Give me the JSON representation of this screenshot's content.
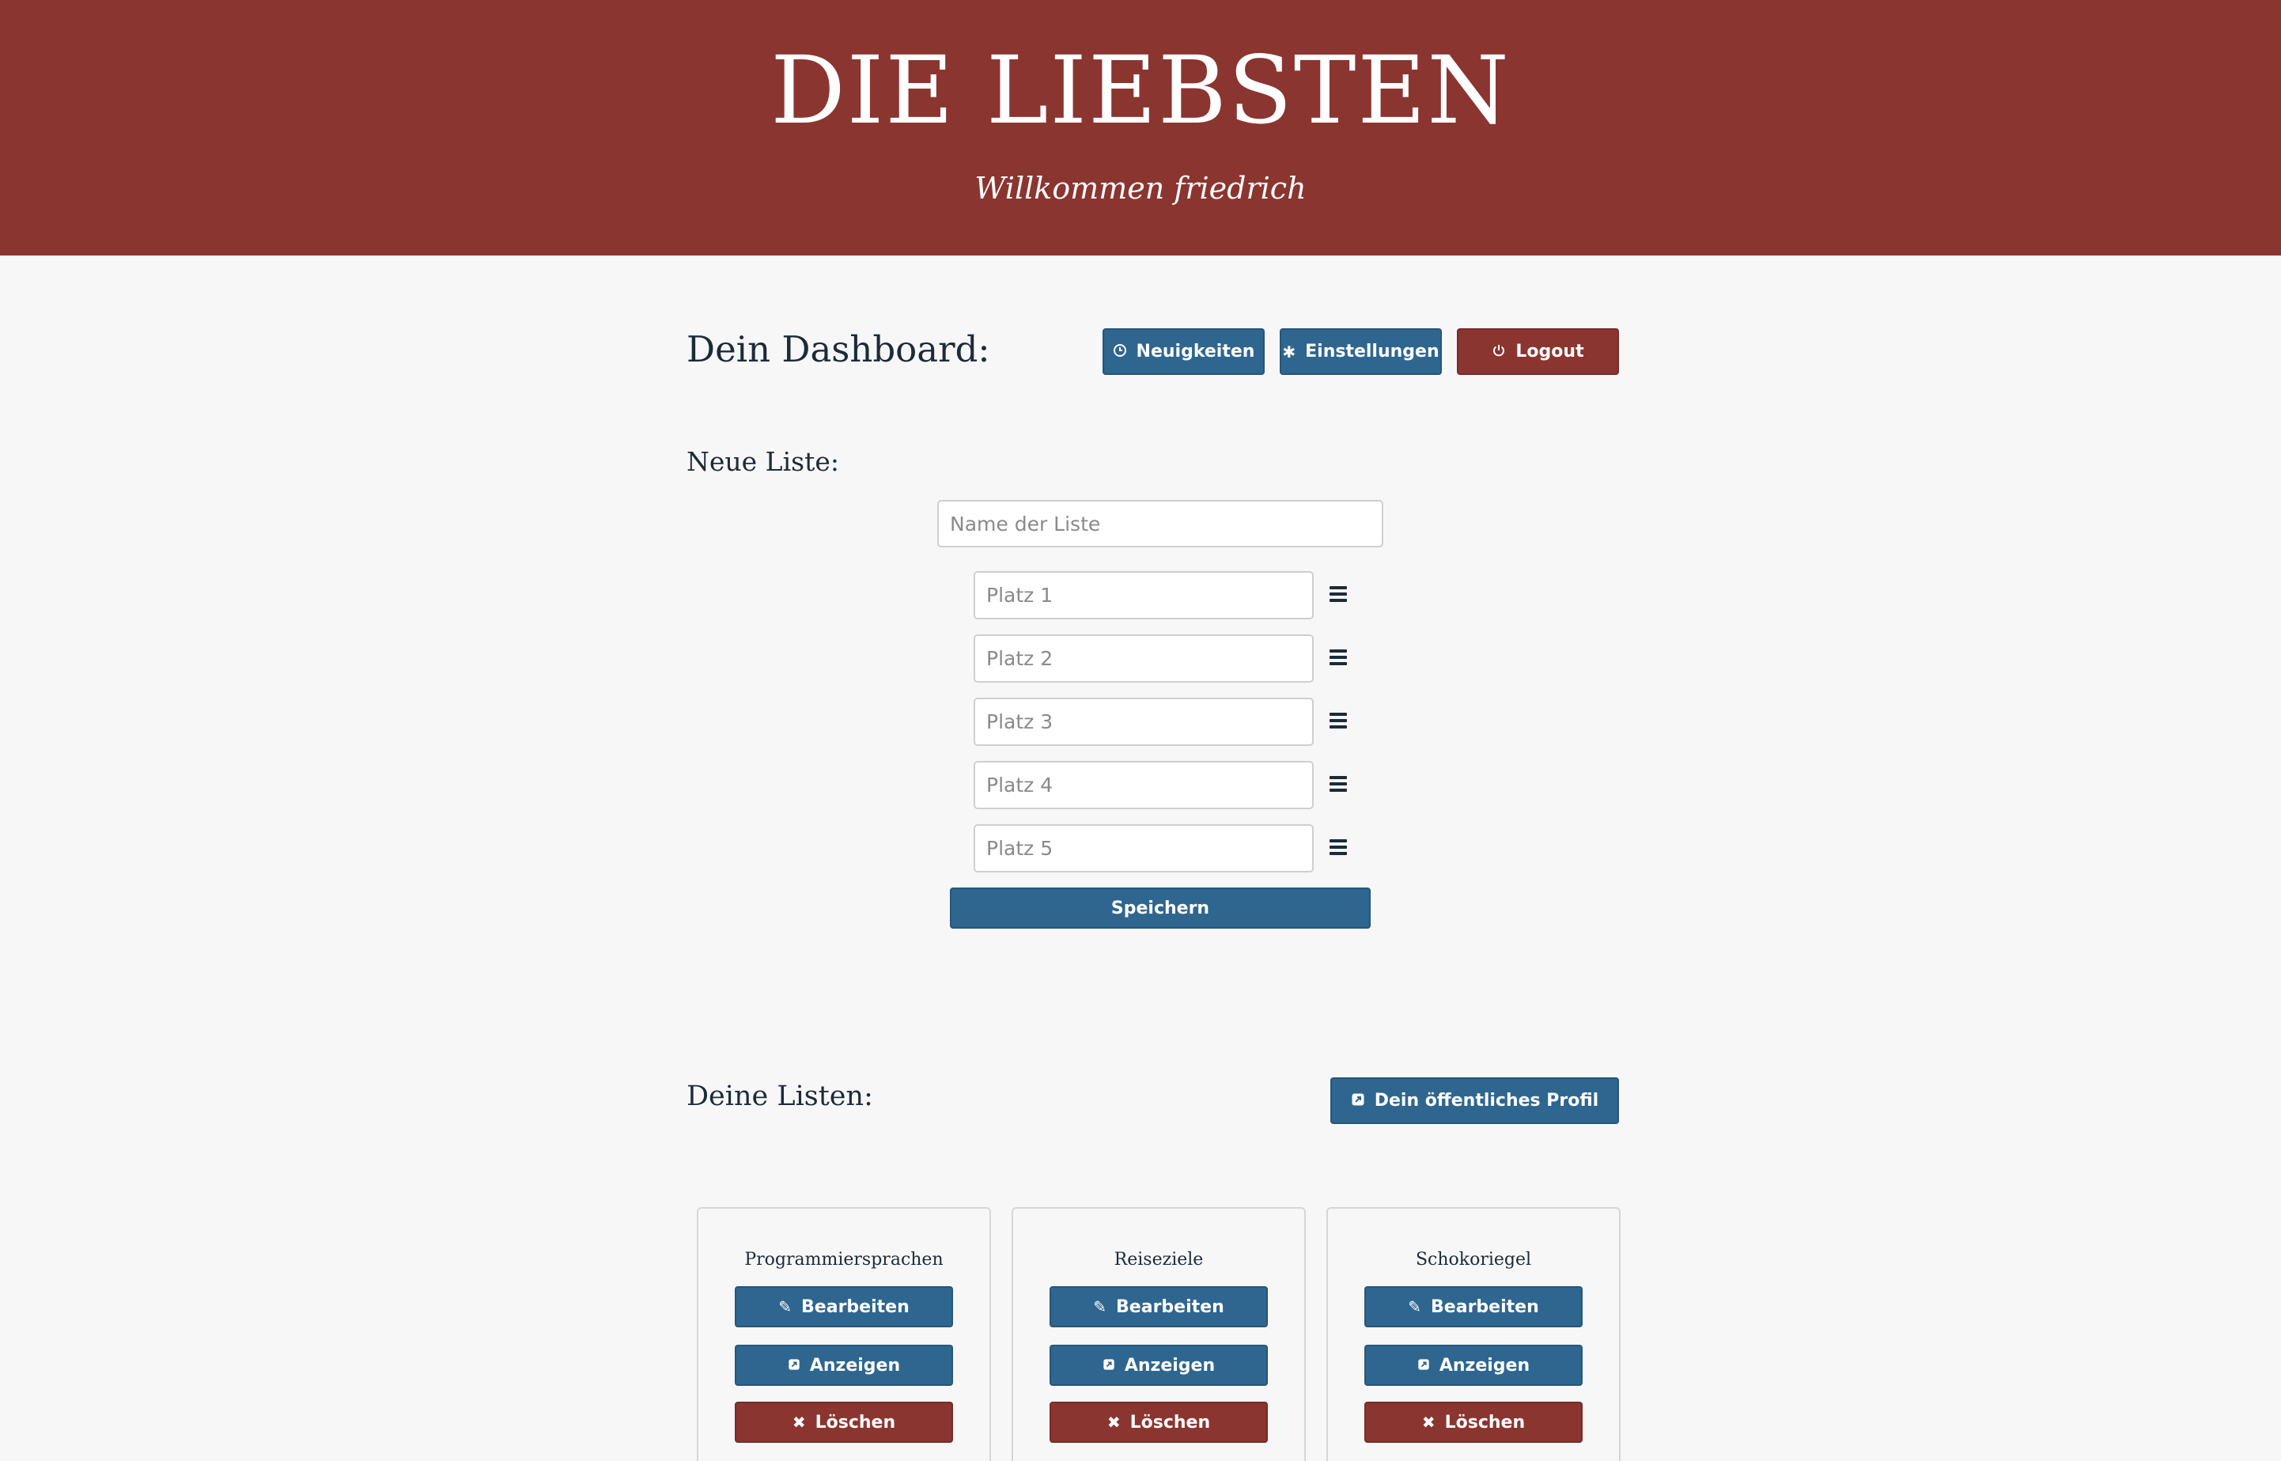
{
  "header": {
    "brand": "DIE LIEBSTEN",
    "welcome": "Willkommen friedrich"
  },
  "dashboard": {
    "title": "Dein Dashboard:",
    "news_label": "Neuigkeiten",
    "settings_label": "Einstellungen",
    "logout_label": "Logout"
  },
  "new_list": {
    "title": "Neue Liste:",
    "name_placeholder": "Name der Liste",
    "places": [
      {
        "placeholder": "Platz 1"
      },
      {
        "placeholder": "Platz 2"
      },
      {
        "placeholder": "Platz 3"
      },
      {
        "placeholder": "Platz 4"
      },
      {
        "placeholder": "Platz 5"
      }
    ],
    "save_label": "Speichern"
  },
  "lists": {
    "title": "Deine Listen:",
    "profile_label": "Dein öffentliches Profil",
    "items": [
      {
        "name": "Programmiersprachen",
        "edit_label": "Bearbeiten",
        "view_label": "Anzeigen",
        "delete_label": "Löschen"
      },
      {
        "name": "Reiseziele",
        "edit_label": "Bearbeiten",
        "view_label": "Anzeigen",
        "delete_label": "Löschen"
      },
      {
        "name": "Schokoriegel",
        "edit_label": "Bearbeiten",
        "view_label": "Anzeigen",
        "delete_label": "Löschen"
      }
    ]
  },
  "icons": {
    "news": "clock-icon",
    "settings": "gear-icon",
    "logout": "power-icon",
    "drag": "drag-handle-icon",
    "profile": "external-link-icon",
    "edit": "edit-icon",
    "view": "external-link-icon",
    "delete": "close-icon"
  },
  "colors": {
    "brand_red": "#8b3530",
    "primary_blue": "#2e6690",
    "background": "#f7f7f7"
  }
}
